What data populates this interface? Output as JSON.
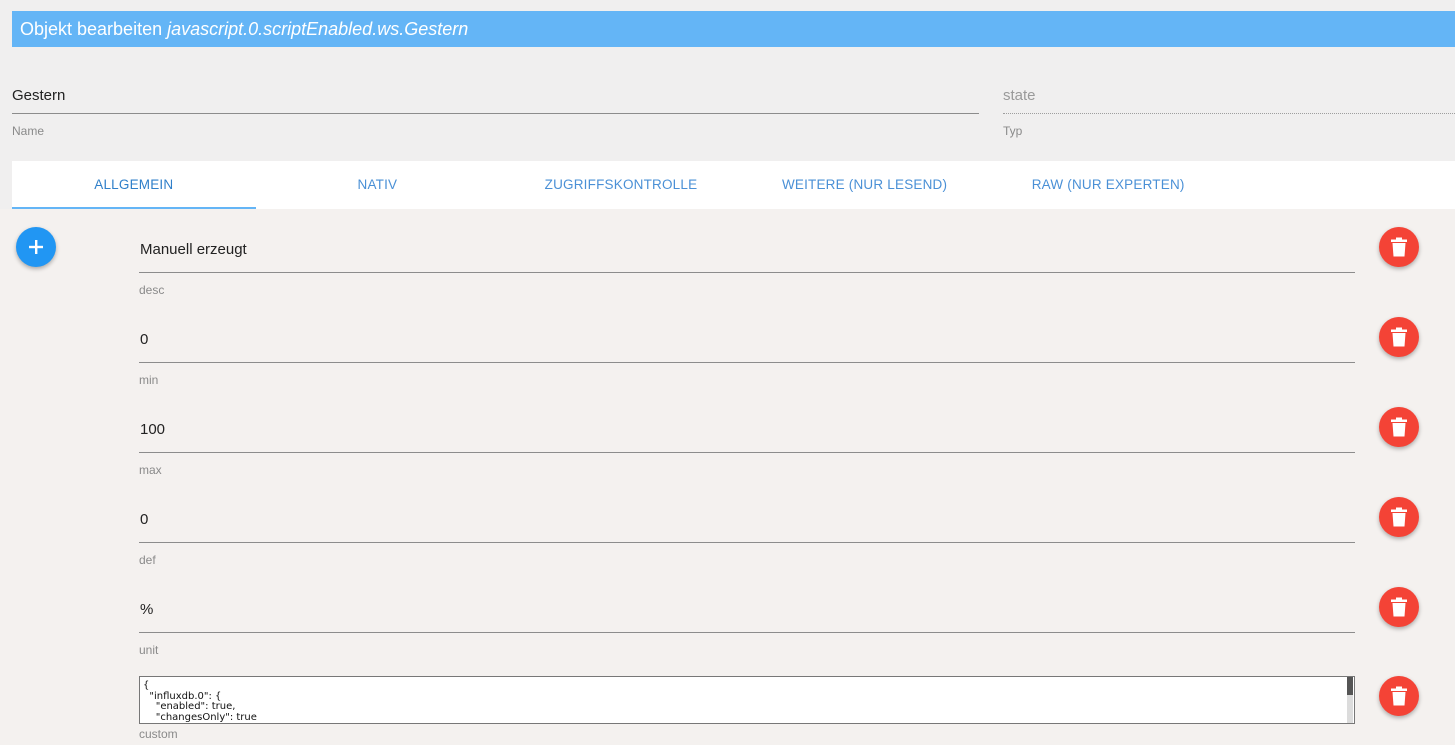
{
  "header": {
    "title_prefix": "Objekt bearbeiten ",
    "object_id": "javascript.0.scriptEnabled.ws.Gestern"
  },
  "name_field": {
    "value": "Gestern",
    "label": "Name"
  },
  "type_field": {
    "value": "state",
    "label": "Typ"
  },
  "tabs": [
    {
      "label": "ALLGEMEIN",
      "active": true
    },
    {
      "label": "NATIV",
      "active": false
    },
    {
      "label": "ZUGRIFFSKONTROLLE",
      "active": false
    },
    {
      "label": "WEITERE (NUR LESEND)",
      "active": false
    },
    {
      "label": "RAW (NUR EXPERTEN)",
      "active": false
    }
  ],
  "fields": [
    {
      "value": "Manuell erzeugt",
      "label": "desc"
    },
    {
      "value": "0",
      "label": "min"
    },
    {
      "value": "100",
      "label": "max"
    },
    {
      "value": "0",
      "label": "def"
    },
    {
      "value": "%",
      "label": "unit"
    }
  ],
  "custom": {
    "label": "custom",
    "text": "{\n  \"influxdb.0\": {\n    \"enabled\": true,\n    \"changesOnly\": true"
  },
  "colors": {
    "titlebar": "#64b5f6",
    "add_button": "#2196f3",
    "delete_button": "#f44336",
    "tab_text": "#4a90d6"
  },
  "icons": {
    "add": "plus-icon",
    "delete": "trash-icon"
  }
}
